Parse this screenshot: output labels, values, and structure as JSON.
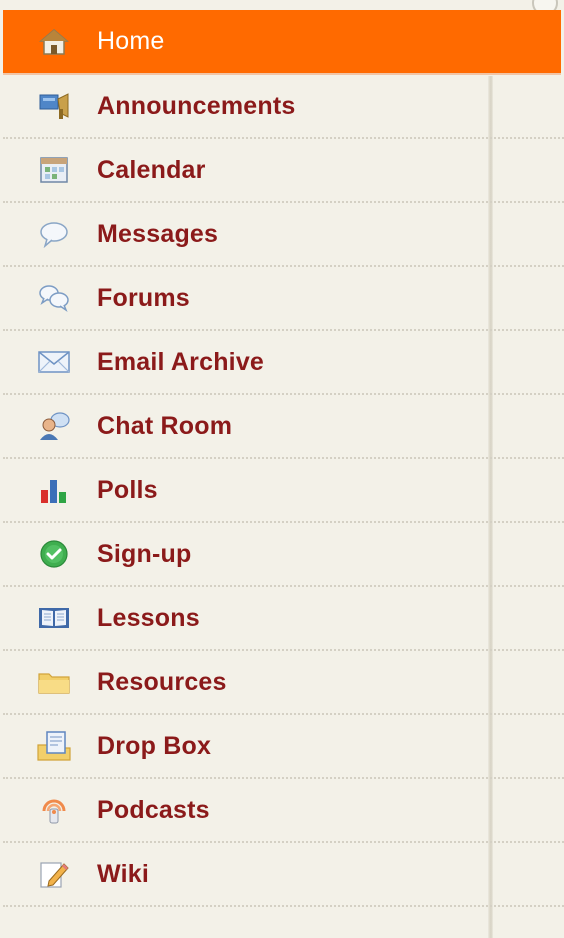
{
  "nav": {
    "items": [
      {
        "label": "Home",
        "icon": "home-icon",
        "active": true
      },
      {
        "label": "Announcements",
        "icon": "megaphone-icon",
        "active": false
      },
      {
        "label": "Calendar",
        "icon": "calendar-icon",
        "active": false
      },
      {
        "label": "Messages",
        "icon": "speech-bubble-icon",
        "active": false
      },
      {
        "label": "Forums",
        "icon": "forum-bubbles-icon",
        "active": false
      },
      {
        "label": "Email Archive",
        "icon": "envelope-icon",
        "active": false
      },
      {
        "label": "Chat Room",
        "icon": "chat-user-icon",
        "active": false
      },
      {
        "label": "Polls",
        "icon": "bar-chart-icon",
        "active": false
      },
      {
        "label": "Sign-up",
        "icon": "check-circle-icon",
        "active": false
      },
      {
        "label": "Lessons",
        "icon": "open-book-icon",
        "active": false
      },
      {
        "label": "Resources",
        "icon": "folder-icon",
        "active": false
      },
      {
        "label": "Drop Box",
        "icon": "dropbox-icon",
        "active": false
      },
      {
        "label": "Podcasts",
        "icon": "podcast-icon",
        "active": false
      },
      {
        "label": "Wiki",
        "icon": "pencil-icon",
        "active": false
      }
    ]
  },
  "colors": {
    "active_bg": "#ff6a00",
    "link_text": "#8b1a1a",
    "background": "#f3f1e8"
  }
}
